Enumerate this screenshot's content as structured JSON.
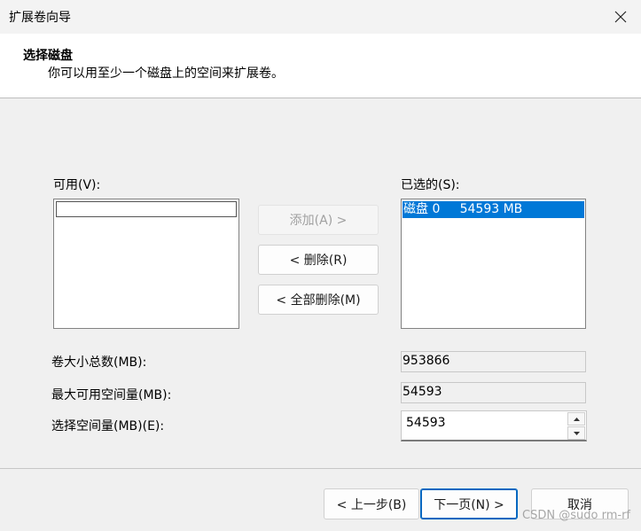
{
  "window": {
    "title": "扩展卷向导"
  },
  "header": {
    "title": "选择磁盘",
    "subtitle": "你可以用至少一个磁盘上的空间来扩展卷。"
  },
  "available": {
    "label": "可用(V):"
  },
  "selected": {
    "label": "已选的(S):",
    "items": [
      {
        "text": "磁盘 0     54593 MB"
      }
    ]
  },
  "buttons": {
    "add": "添加(A) >",
    "remove": "< 删除(R)",
    "remove_all": "< 全部删除(M)",
    "back": "< 上一步(B)",
    "next": "下一页(N) >",
    "cancel": "取消"
  },
  "fields": {
    "total_size_label": "卷大小总数(MB):",
    "total_size_value": "953866",
    "max_available_label": "最大可用空间量(MB):",
    "max_available_value": "54593",
    "select_amount_label": "选择空间量(MB)(E):",
    "select_amount_value": "54593"
  },
  "watermark": "CSDN @sudo rm-rf"
}
